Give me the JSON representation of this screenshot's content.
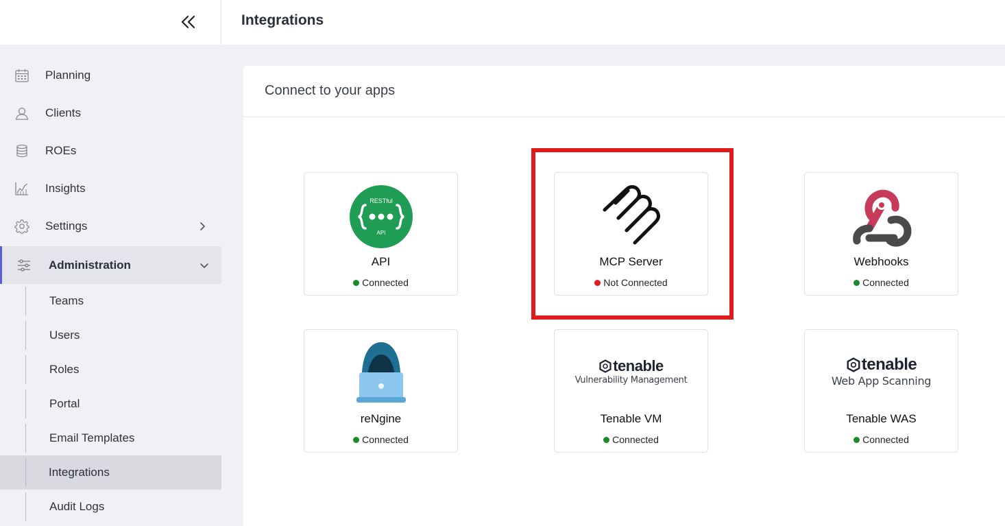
{
  "header": {
    "title": "Integrations"
  },
  "sidebar": {
    "items": [
      {
        "label": "Planning",
        "icon": "calendar-icon"
      },
      {
        "label": "Clients",
        "icon": "user-icon"
      },
      {
        "label": "ROEs",
        "icon": "database-icon"
      },
      {
        "label": "Insights",
        "icon": "chart-icon"
      },
      {
        "label": "Settings",
        "icon": "gear-icon",
        "expand": "chevron-right-icon"
      },
      {
        "label": "Administration",
        "icon": "sliders-icon",
        "expand": "chevron-down-icon",
        "active": true
      }
    ],
    "subitems": [
      {
        "label": "Teams"
      },
      {
        "label": "Users"
      },
      {
        "label": "Roles"
      },
      {
        "label": "Portal"
      },
      {
        "label": "Email Templates"
      },
      {
        "label": "Integrations",
        "selected": true
      },
      {
        "label": "Audit Logs"
      }
    ]
  },
  "main": {
    "title": "Connect to your apps",
    "integrations": [
      {
        "name": "API",
        "status": "Connected",
        "status_color": "#1a8a2a",
        "logo_text_top": "RESTful",
        "logo_text_bottom": "API",
        "logo_color": "#1f9d55"
      },
      {
        "name": "MCP Server",
        "status": "Not Connected",
        "status_color": "#e11d1d"
      },
      {
        "name": "Webhooks",
        "status": "Connected",
        "status_color": "#1a8a2a"
      },
      {
        "name": "reNgine",
        "status": "Connected",
        "status_color": "#1a8a2a"
      },
      {
        "name": "Tenable VM",
        "status": "Connected",
        "status_color": "#1a8a2a",
        "logo_word": "tenable",
        "logo_sub": "Vulnerability Management"
      },
      {
        "name": "Tenable WAS",
        "status": "Connected",
        "status_color": "#1a8a2a",
        "logo_word": "tenable",
        "logo_sub": "Web App Scanning"
      }
    ],
    "highlight_color": "#e01b1b"
  }
}
